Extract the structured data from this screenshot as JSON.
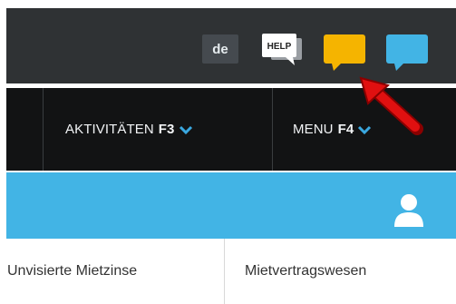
{
  "topbar": {
    "language": "de",
    "help_label": "HELP",
    "icons": [
      "help-speech-icon",
      "chat-yellow-icon",
      "chat-blue-icon"
    ]
  },
  "nav": {
    "items": [
      {
        "label": "AKTIVITÄTEN",
        "key": "F3"
      },
      {
        "label": "MENU",
        "key": "F4"
      }
    ]
  },
  "bluebar": {
    "icon": "user-icon"
  },
  "tabs": [
    {
      "label": "Unvisierte Mietzinse"
    },
    {
      "label": "Mietvertragswesen"
    }
  ],
  "colors": {
    "topbar_bg": "#2f3234",
    "nav_bg": "#121314",
    "accent_blue": "#42b4e5",
    "chat_yellow": "#f5b400",
    "arrow_red": "#e01010"
  }
}
